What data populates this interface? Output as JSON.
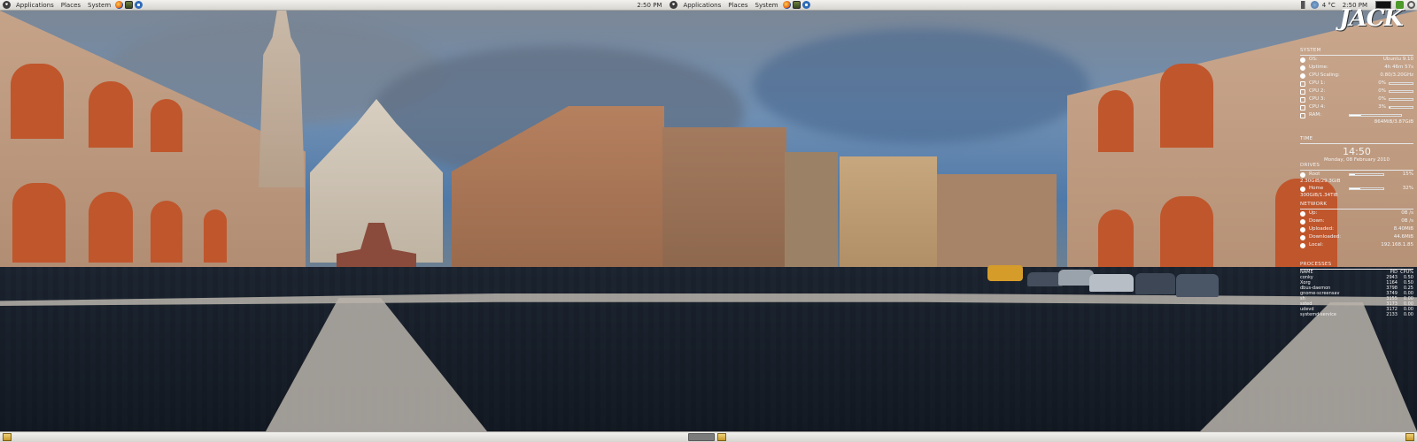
{
  "top_panel": {
    "menus": [
      "Applications",
      "Places",
      "System"
    ],
    "clock": "2:50 PM",
    "menus_mirror": [
      "Applications",
      "Places",
      "System"
    ],
    "weather": "4 °C",
    "clock_right": "2:50 PM"
  },
  "conky": {
    "logo": "JACK",
    "system": {
      "header": "SYSTEM",
      "rows": [
        {
          "label": "OS:",
          "value": "Ubuntu 9.10"
        },
        {
          "label": "Uptime:",
          "value": "4h 46m 57s"
        },
        {
          "label": "CPU Scaling:",
          "value": "0.80/3.20GHz"
        }
      ],
      "cpus": [
        {
          "label": "CPU 1:",
          "value": "0%",
          "fill": 0
        },
        {
          "label": "CPU 2:",
          "value": "0%",
          "fill": 0
        },
        {
          "label": "CPU 3:",
          "value": "0%",
          "fill": 0
        },
        {
          "label": "CPU 4:",
          "value": "3%",
          "fill": 0.03
        }
      ],
      "ram": {
        "label": "RAM:",
        "value": "864MiB/3.87GiB",
        "fill": 0.22
      }
    },
    "time": {
      "header": "TIME",
      "clock": "14:50",
      "date": "Monday, 08 February 2010"
    },
    "drives": {
      "header": "DRIVES",
      "rows": [
        {
          "label": "Root",
          "value": "15%",
          "detail": "2.30GiB/29.3GiB",
          "fill": 0.15
        },
        {
          "label": "Home",
          "value": "32%",
          "detail": "300GiB/1.34TiB",
          "fill": 0.32
        }
      ]
    },
    "network": {
      "header": "NETWORK",
      "rows": [
        {
          "label": "Up:",
          "value": "0B /s"
        },
        {
          "label": "Down:",
          "value": "0B /s"
        },
        {
          "label": "Uploaded:",
          "value": "8.40MiB"
        },
        {
          "label": "Downloaded:",
          "value": "44.6MiB"
        },
        {
          "label": "Local:",
          "value": "192.168.1.85"
        }
      ]
    },
    "processes": {
      "header": "PROCESSES",
      "columns": [
        "NAME",
        "PID",
        "CPU%"
      ],
      "rows": [
        [
          "conky",
          "2943",
          "0.50"
        ],
        [
          "Xorg",
          "1164",
          "0.50"
        ],
        [
          "dbus-daemon",
          "3798",
          "0.25"
        ],
        [
          "gnome-screensav",
          "3749",
          "0.00"
        ],
        [
          "sh",
          "3155",
          "0.00"
        ],
        [
          "ssted",
          "3173",
          "0.00"
        ],
        [
          "udevd",
          "3172",
          "0.00"
        ],
        [
          "systemd-service",
          "2133",
          "0.00"
        ]
      ]
    }
  },
  "colors": {
    "panel_top": "#f2f1ee",
    "panel_bottom": "#d7d5d0",
    "conky_text": "#f4f4f4",
    "arch_brick": "#c0562c"
  }
}
